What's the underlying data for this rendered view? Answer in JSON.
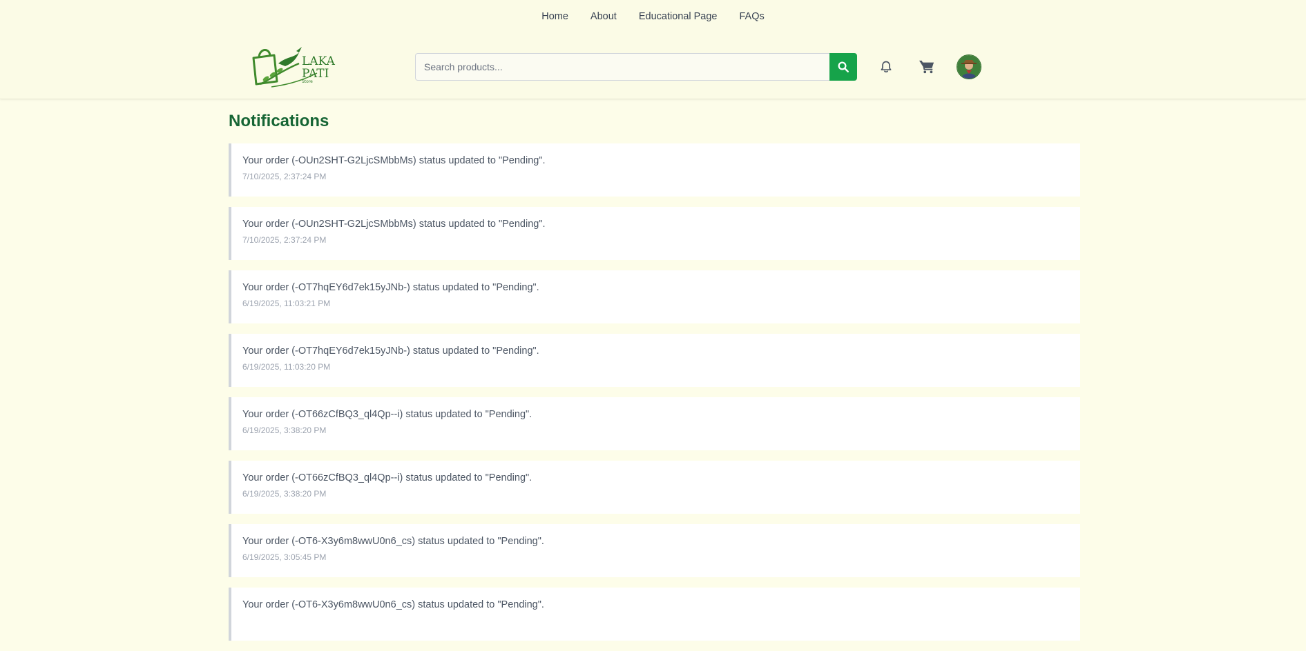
{
  "nav": {
    "links": [
      "Home",
      "About",
      "Educational Page",
      "FAQs"
    ]
  },
  "logo": {
    "line1": "LAKA",
    "line2": "PATI",
    "line3": "Store"
  },
  "search": {
    "placeholder": "Search products...",
    "value": "",
    "button_icon": "search-icon"
  },
  "header_icons": {
    "notifications": "bell-icon",
    "cart": "cart-icon",
    "profile": "avatar"
  },
  "colors": {
    "accent": "#16a34a",
    "title": "#166534",
    "background": "#fdfde9"
  },
  "page": {
    "title": "Notifications"
  },
  "notifications": [
    {
      "message": "Your order (-OUn2SHT-G2LjcSMbbMs) status updated to \"Pending\".",
      "time": "7/10/2025, 2:37:24 PM"
    },
    {
      "message": "Your order (-OUn2SHT-G2LjcSMbbMs) status updated to \"Pending\".",
      "time": "7/10/2025, 2:37:24 PM"
    },
    {
      "message": "Your order (-OT7hqEY6d7ek15yJNb-) status updated to \"Pending\".",
      "time": "6/19/2025, 11:03:21 PM"
    },
    {
      "message": "Your order (-OT7hqEY6d7ek15yJNb-) status updated to \"Pending\".",
      "time": "6/19/2025, 11:03:20 PM"
    },
    {
      "message": "Your order (-OT66zCfBQ3_ql4Qp--i) status updated to \"Pending\".",
      "time": "6/19/2025, 3:38:20 PM"
    },
    {
      "message": "Your order (-OT66zCfBQ3_ql4Qp--i) status updated to \"Pending\".",
      "time": "6/19/2025, 3:38:20 PM"
    },
    {
      "message": "Your order (-OT6-X3y6m8wwU0n6_cs) status updated to \"Pending\".",
      "time": "6/19/2025, 3:05:45 PM"
    },
    {
      "message": "Your order (-OT6-X3y6m8wwU0n6_cs) status updated to \"Pending\".",
      "time": ""
    }
  ]
}
